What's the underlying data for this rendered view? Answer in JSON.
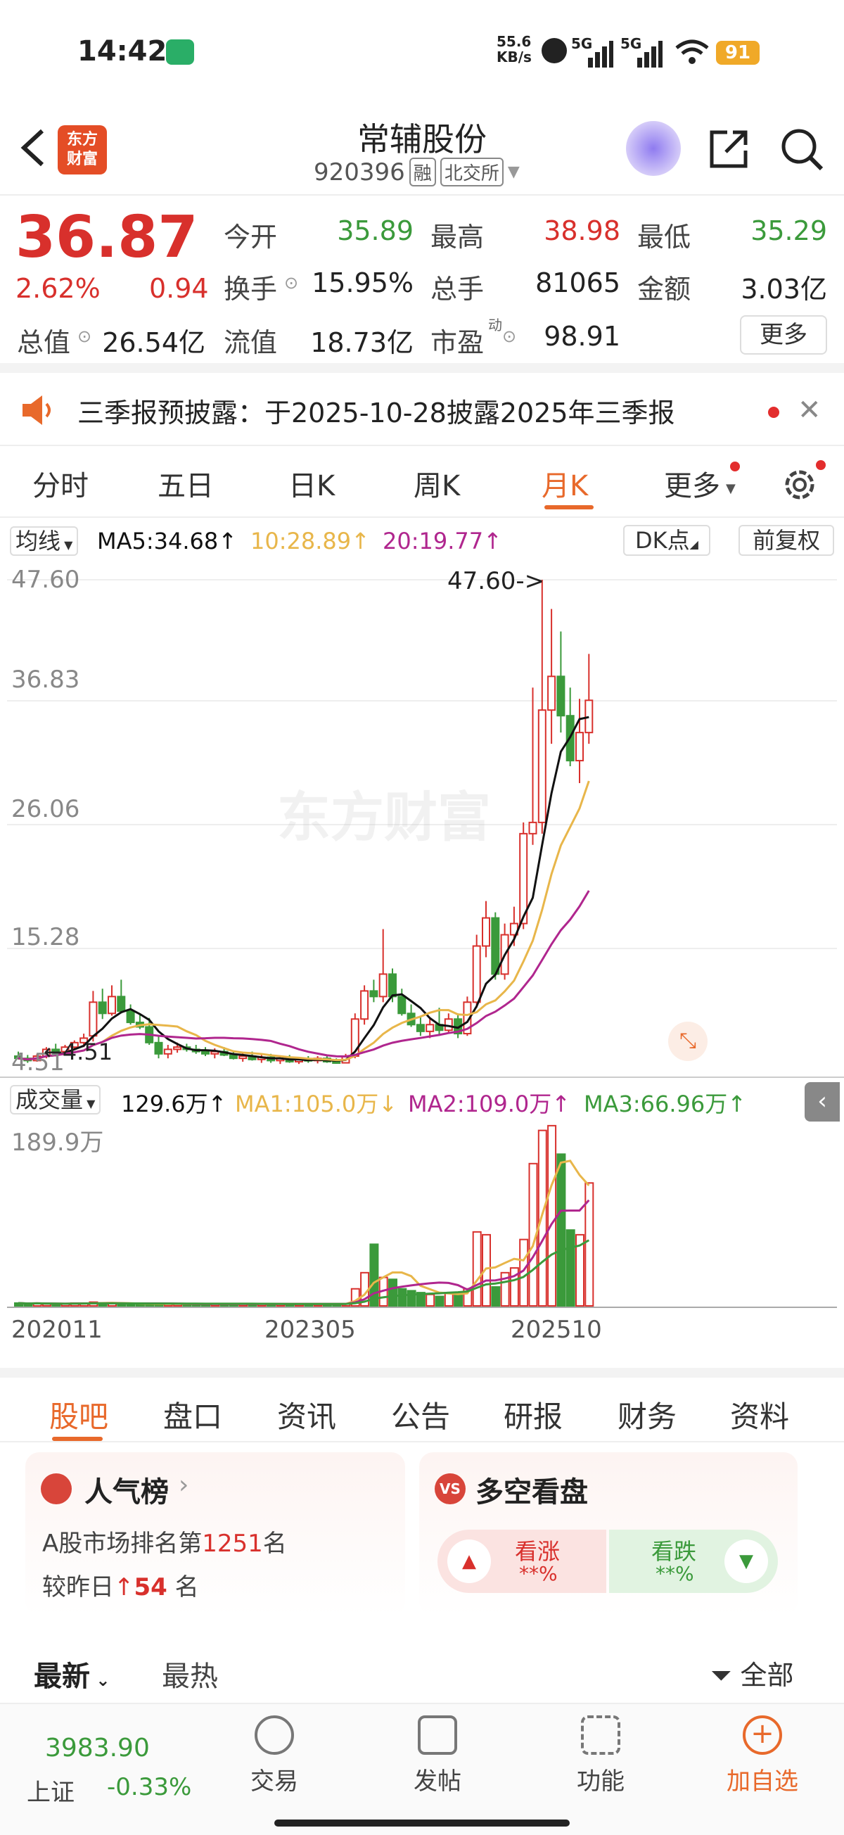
{
  "status": {
    "time": "14:42",
    "net_speed": "55.6",
    "net_unit": "KB/s",
    "sig1": "5G",
    "sig2": "5G",
    "battery": "91"
  },
  "header": {
    "logo_line1": "东方",
    "logo_line2": "财富",
    "title": "常辅股份",
    "code": "920396",
    "tag1": "融",
    "tag2": "北交所"
  },
  "quote": {
    "price": "36.87",
    "pct": "2.62%",
    "chg": "0.94",
    "total_cap_label": "总值",
    "total_cap": "26.54亿",
    "open_label": "今开",
    "open": "35.89",
    "high_label": "最高",
    "high": "38.98",
    "low_label": "最低",
    "low": "35.29",
    "turnover_label": "换手",
    "turnover": "15.95%",
    "vol_label": "总手",
    "vol": "81065",
    "amount_label": "金额",
    "amount": "3.03亿",
    "float_cap_label": "流值",
    "float_cap": "18.73亿",
    "pe_label": "市盈",
    "pe_sup": "动",
    "pe": "98.91",
    "more": "更多"
  },
  "notice": {
    "text": "三季报预披露：于2025-10-28披露2025年三季报"
  },
  "tabs": [
    "分时",
    "五日",
    "日K",
    "周K",
    "月K",
    "更多"
  ],
  "active_tab": "月K",
  "ma": {
    "selector": "均线",
    "ma5": "MA5:34.68",
    "ma10": "10:28.89",
    "ma20": "20:19.77",
    "dk": "DK点",
    "adjust": "前复权"
  },
  "kchart": {
    "y_ticks": [
      "47.60",
      "36.83",
      "26.06",
      "15.28",
      "4.51"
    ],
    "max_label": "47.60->",
    "min_label": "4.51",
    "watermark": "东方财富"
  },
  "vol": {
    "selector": "成交量",
    "value": "129.6万",
    "ma1": "MA1:105.0万",
    "ma2": "MA2:109.0万",
    "ma3": "MA3:66.96万",
    "ymax": "189.9万"
  },
  "dates": [
    "202011",
    "202305",
    "202510"
  ],
  "subtabs": [
    "股吧",
    "盘口",
    "资讯",
    "公告",
    "研报",
    "财务",
    "资料"
  ],
  "active_subtab": "股吧",
  "popularity": {
    "title": "人气榜",
    "line1_pre": "A股市场排名第",
    "rank": "1251",
    "line1_post": "名",
    "line2_pre": "较昨日",
    "delta": "54",
    "line2_post": "名"
  },
  "longshort": {
    "title": "多空看盘",
    "up_label": "看涨",
    "up_val": "**%",
    "down_label": "看跌",
    "down_val": "**%"
  },
  "feed": {
    "latest": "最新",
    "hot": "最热",
    "filter": "全部"
  },
  "bottom": {
    "index_value": "3983.90",
    "index_name": "上证",
    "index_chg": "-0.33%",
    "trade": "交易",
    "post": "发帖",
    "func": "功能",
    "add": "加自选"
  },
  "colors": {
    "up": "#d8302c",
    "down": "#3b9a3b",
    "accent": "#e8692b",
    "ma5": "#111111",
    "ma10": "#e8b64a",
    "ma20": "#b0268e"
  },
  "chart_data": {
    "type": "candlestick",
    "period": "monthly",
    "ylim": [
      4.51,
      47.6
    ],
    "candles": [
      {
        "o": 5.2,
        "h": 5.6,
        "l": 4.9,
        "c": 5.0
      },
      {
        "o": 5.0,
        "h": 5.3,
        "l": 4.6,
        "c": 4.8
      },
      {
        "o": 4.8,
        "h": 5.4,
        "l": 4.7,
        "c": 5.2
      },
      {
        "o": 5.2,
        "h": 6.0,
        "l": 5.0,
        "c": 5.8
      },
      {
        "o": 5.8,
        "h": 6.3,
        "l": 5.4,
        "c": 5.6
      },
      {
        "o": 5.6,
        "h": 6.2,
        "l": 5.3,
        "c": 6.0
      },
      {
        "o": 6.0,
        "h": 6.6,
        "l": 5.8,
        "c": 6.4
      },
      {
        "o": 6.4,
        "h": 7.2,
        "l": 6.0,
        "c": 6.8
      },
      {
        "o": 7.0,
        "h": 11.0,
        "l": 6.5,
        "c": 10.0
      },
      {
        "o": 10.0,
        "h": 11.2,
        "l": 8.5,
        "c": 9.0
      },
      {
        "o": 9.0,
        "h": 11.5,
        "l": 8.8,
        "c": 10.5
      },
      {
        "o": 10.5,
        "h": 12.0,
        "l": 9.0,
        "c": 9.2
      },
      {
        "o": 9.2,
        "h": 9.8,
        "l": 8.0,
        "c": 8.2
      },
      {
        "o": 8.2,
        "h": 9.0,
        "l": 7.6,
        "c": 7.8
      },
      {
        "o": 7.8,
        "h": 8.6,
        "l": 6.2,
        "c": 6.4
      },
      {
        "o": 6.4,
        "h": 7.0,
        "l": 5.0,
        "c": 5.4
      },
      {
        "o": 5.4,
        "h": 6.2,
        "l": 5.0,
        "c": 5.8
      },
      {
        "o": 5.8,
        "h": 6.4,
        "l": 5.5,
        "c": 6.0
      },
      {
        "o": 6.0,
        "h": 6.3,
        "l": 5.6,
        "c": 5.8
      },
      {
        "o": 5.8,
        "h": 6.2,
        "l": 5.4,
        "c": 5.6
      },
      {
        "o": 5.6,
        "h": 6.0,
        "l": 5.2,
        "c": 5.4
      },
      {
        "o": 5.4,
        "h": 5.9,
        "l": 5.0,
        "c": 5.6
      },
      {
        "o": 5.6,
        "h": 6.0,
        "l": 5.2,
        "c": 5.3
      },
      {
        "o": 5.3,
        "h": 5.6,
        "l": 4.9,
        "c": 5.0
      },
      {
        "o": 5.0,
        "h": 5.5,
        "l": 4.7,
        "c": 5.2
      },
      {
        "o": 5.2,
        "h": 5.6,
        "l": 4.8,
        "c": 4.9
      },
      {
        "o": 4.9,
        "h": 5.3,
        "l": 4.6,
        "c": 5.1
      },
      {
        "o": 5.1,
        "h": 5.4,
        "l": 4.6,
        "c": 4.8
      },
      {
        "o": 4.8,
        "h": 5.2,
        "l": 4.5,
        "c": 5.0
      },
      {
        "o": 5.0,
        "h": 5.3,
        "l": 4.6,
        "c": 4.7
      },
      {
        "o": 4.7,
        "h": 5.1,
        "l": 4.5,
        "c": 4.9
      },
      {
        "o": 4.9,
        "h": 5.2,
        "l": 4.6,
        "c": 4.8
      },
      {
        "o": 4.8,
        "h": 5.2,
        "l": 4.55,
        "c": 5.0
      },
      {
        "o": 5.0,
        "h": 5.3,
        "l": 4.6,
        "c": 4.7
      },
      {
        "o": 4.7,
        "h": 5.0,
        "l": 4.51,
        "c": 4.6
      },
      {
        "o": 4.6,
        "h": 5.4,
        "l": 4.55,
        "c": 5.2
      },
      {
        "o": 5.2,
        "h": 9.0,
        "l": 5.0,
        "c": 8.5
      },
      {
        "o": 8.5,
        "h": 11.5,
        "l": 8.0,
        "c": 11.0
      },
      {
        "o": 11.0,
        "h": 12.0,
        "l": 10.0,
        "c": 10.5
      },
      {
        "o": 10.5,
        "h": 16.5,
        "l": 10.0,
        "c": 12.5
      },
      {
        "o": 12.5,
        "h": 13.0,
        "l": 10.0,
        "c": 10.5
      },
      {
        "o": 10.5,
        "h": 11.2,
        "l": 8.8,
        "c": 9.0
      },
      {
        "o": 9.0,
        "h": 9.8,
        "l": 7.8,
        "c": 8.0
      },
      {
        "o": 8.0,
        "h": 8.8,
        "l": 7.0,
        "c": 7.4
      },
      {
        "o": 7.4,
        "h": 8.5,
        "l": 6.8,
        "c": 8.0
      },
      {
        "o": 8.0,
        "h": 9.5,
        "l": 7.0,
        "c": 7.5
      },
      {
        "o": 7.5,
        "h": 9.0,
        "l": 7.2,
        "c": 8.5
      },
      {
        "o": 8.5,
        "h": 9.0,
        "l": 6.8,
        "c": 7.2
      },
      {
        "o": 7.2,
        "h": 10.5,
        "l": 7.0,
        "c": 10.0
      },
      {
        "o": 10.0,
        "h": 16.0,
        "l": 9.5,
        "c": 15.0
      },
      {
        "o": 15.0,
        "h": 19.0,
        "l": 14.0,
        "c": 17.5
      },
      {
        "o": 17.5,
        "h": 18.0,
        "l": 12.0,
        "c": 12.5
      },
      {
        "o": 12.5,
        "h": 17.0,
        "l": 12.0,
        "c": 16.0
      },
      {
        "o": 16.0,
        "h": 18.5,
        "l": 15.0,
        "c": 17.0
      },
      {
        "o": 17.0,
        "h": 26.0,
        "l": 16.5,
        "c": 25.0
      },
      {
        "o": 25.0,
        "h": 38.0,
        "l": 24.0,
        "c": 26.0
      },
      {
        "o": 26.0,
        "h": 47.6,
        "l": 25.0,
        "c": 36.0
      },
      {
        "o": 36.0,
        "h": 45.0,
        "l": 33.0,
        "c": 39.0
      },
      {
        "o": 39.0,
        "h": 43.0,
        "l": 34.0,
        "c": 35.5
      },
      {
        "o": 35.5,
        "h": 38.0,
        "l": 31.0,
        "c": 31.5
      },
      {
        "o": 31.5,
        "h": 37.0,
        "l": 29.5,
        "c": 34.0
      },
      {
        "o": 34.0,
        "h": 41.0,
        "l": 33.0,
        "c": 36.87
      }
    ],
    "ma5_last": 34.68,
    "ma10_last": 28.89,
    "ma20_last": 19.77,
    "volume_max": 189.9,
    "volume_unit": "万",
    "volumes": [
      3,
      2,
      3,
      2,
      2,
      2,
      3,
      3,
      4,
      3,
      3,
      2,
      2,
      2,
      2,
      2,
      2,
      2,
      2,
      2,
      2,
      2,
      2,
      2,
      2,
      2,
      2,
      2,
      2,
      2,
      2,
      2,
      2,
      2,
      2,
      2,
      18,
      35,
      65,
      30,
      28,
      18,
      16,
      14,
      12,
      10,
      14,
      12,
      18,
      78,
      75,
      20,
      35,
      40,
      70,
      150,
      185,
      190,
      160,
      80,
      75,
      129.6
    ]
  }
}
